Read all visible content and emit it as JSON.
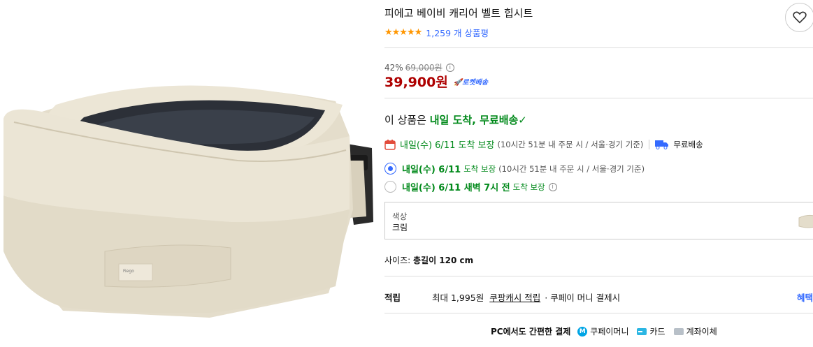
{
  "product": {
    "title": "피에고 베이비 캐리어 벨트 힙시트",
    "stars": "★★★★★",
    "review_count": "1,259 개 상품평",
    "discount_rate": "42%",
    "original_price": "69,000원",
    "price": "39,900원",
    "rocket_badge": "로켓배송"
  },
  "delivery": {
    "headline_prefix": "이 상품은 ",
    "headline_green": "내일 도착, 무료배송",
    "check": "✓",
    "line1_date": "내일(수) 6/11 도착 보장",
    "line1_note": "(10시간 51분 내 주문 시 / 서울·경기 기준)",
    "free_shipping": "무료배송",
    "options": [
      {
        "date": "내일(수) 6/11",
        "label": "도착 보장",
        "note": "(10시간 51분 내 주문 시 / 서울·경기 기준)",
        "selected": true
      },
      {
        "date": "내일(수) 6/11 새벽 7시 전",
        "label": "도착 보장",
        "note": "",
        "selected": false
      }
    ]
  },
  "option": {
    "color_label": "색상",
    "color_value": "크림",
    "size_label": "사이즈: ",
    "size_value": "총길이 120 cm"
  },
  "points": {
    "label": "적립",
    "amount": "최대 1,995원",
    "link": "쿠팡캐시 적립",
    "rest": "· 쿠페이 머니 결제시",
    "benefit": "혜택"
  },
  "payment": {
    "pc_text": "PC에서도 간편한 결제",
    "coupay_icon": "M",
    "coupay": "쿠페이머니",
    "card": "카드",
    "bank": "계좌이체"
  },
  "colors": {
    "price_red": "#ae0000",
    "link_blue": "#346aff",
    "delivery_green": "#00891a",
    "star_orange": "#ff9600"
  }
}
